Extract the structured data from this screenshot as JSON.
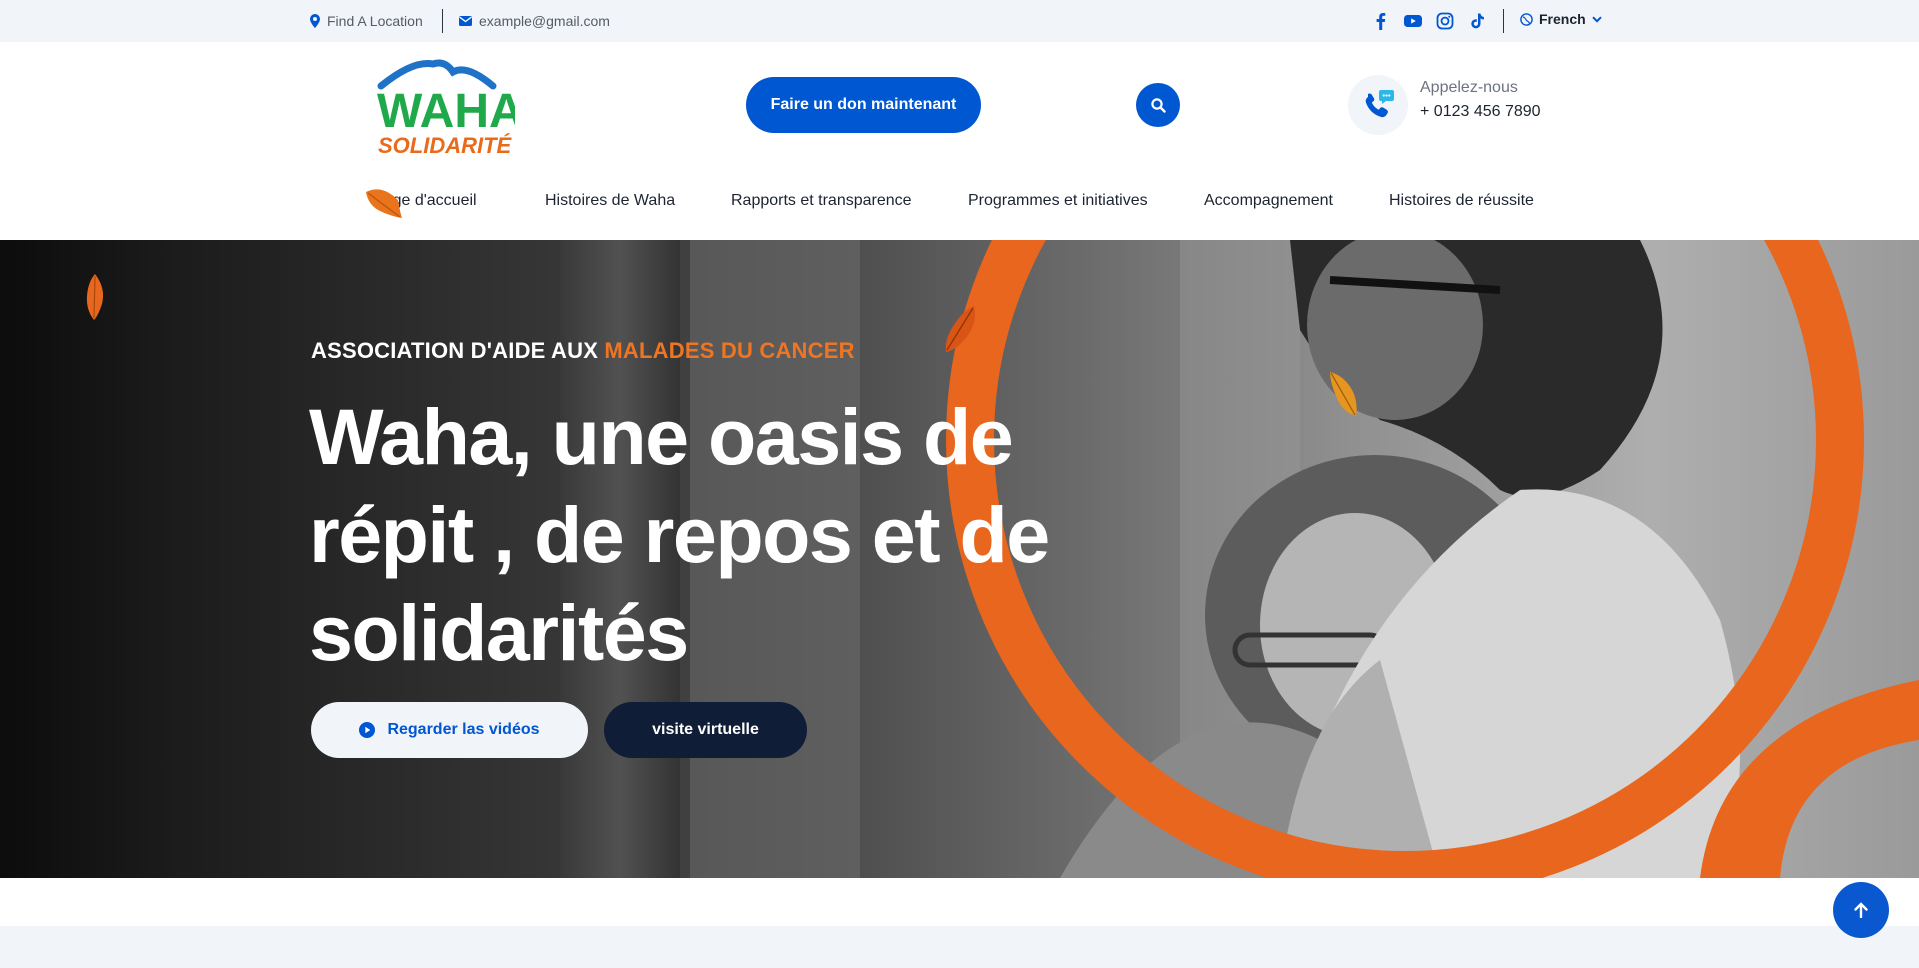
{
  "topbar": {
    "location_label": "Find A Location",
    "email_label": "example@gmail.com",
    "social_icons": [
      "facebook-icon",
      "youtube-icon",
      "instagram-icon",
      "tiktok-icon"
    ],
    "language": "French"
  },
  "header": {
    "logo_word": "WAHA",
    "logo_sub": "SOLIDARITÉ",
    "donate_label": "Faire un don maintenant",
    "call_label": "Appelez-nous",
    "call_number": "+ 0123 456 7890"
  },
  "nav": {
    "items": [
      {
        "label": "Page d'accueil"
      },
      {
        "label": "Histoires de Waha"
      },
      {
        "label": "Rapports et transparence"
      },
      {
        "label": "Programmes et initiatives"
      },
      {
        "label": "Accompagnement"
      },
      {
        "label": "Histoires de réussite"
      }
    ]
  },
  "hero": {
    "eyebrow_prefix": "ASSOCIATION D'AIDE AUX",
    "eyebrow_accent": "MALADES DU CANCER",
    "title": "Waha, une oasis de répit , de repos et de solidarités",
    "btn_videos": "Regarder las vidéos",
    "btn_virtual": "visite virtuelle"
  },
  "colors": {
    "primary": "#0057d2",
    "accent": "#f07522",
    "dark": "#101d36",
    "logo_green": "#1fa94b"
  }
}
